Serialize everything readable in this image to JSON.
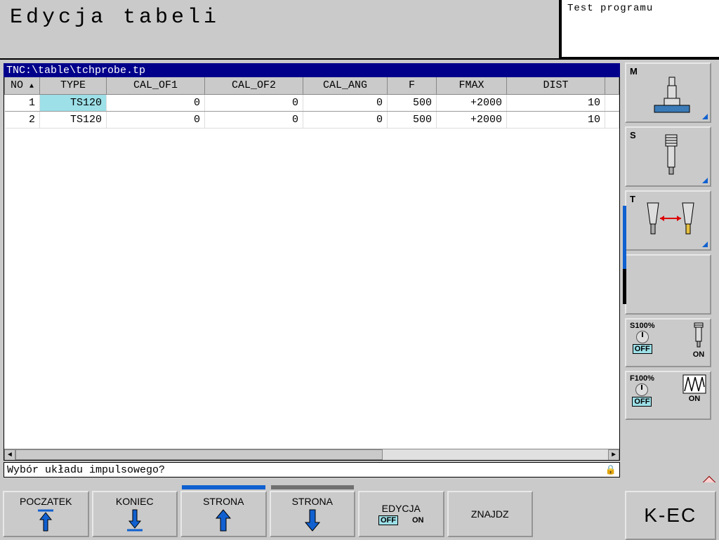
{
  "header": {
    "title": "Edycja tabeli",
    "status": "Test programu"
  },
  "path_bar": "TNC:\\table\\tchprobe.tp",
  "table": {
    "columns": {
      "no": "NO",
      "type": "TYPE",
      "cal_of1": "CAL_OF1",
      "cal_of2": "CAL_OF2",
      "cal_ang": "CAL_ANG",
      "f": "F",
      "fmax": "FMAX",
      "dist": "DIST"
    },
    "rows": [
      {
        "no": "1",
        "type": "TS120",
        "cal_of1": "0",
        "cal_of2": "0",
        "cal_ang": "0",
        "f": "500",
        "fmax": "+2000",
        "dist": "10"
      },
      {
        "no": "2",
        "type": "TS120",
        "cal_of1": "0",
        "cal_of2": "0",
        "cal_ang": "0",
        "f": "500",
        "fmax": "+2000",
        "dist": "10"
      }
    ]
  },
  "prompt": "Wybór układu impulsowego?",
  "sidebar": {
    "m": "M",
    "s": "S",
    "t": "T",
    "s100": {
      "label": "S100%",
      "off": "OFF",
      "on": "ON"
    },
    "f100": {
      "label": "F100%",
      "off": "OFF",
      "on": "ON"
    }
  },
  "softkeys": {
    "k0": "POCZATEK",
    "k1": "KONIEC",
    "k2": "STRONA",
    "k3": "STRONA",
    "k4": {
      "label": "EDYCJA",
      "off": "OFF",
      "on": "ON"
    },
    "k5": "ZNAJDZ",
    "mode": "K-EC"
  }
}
